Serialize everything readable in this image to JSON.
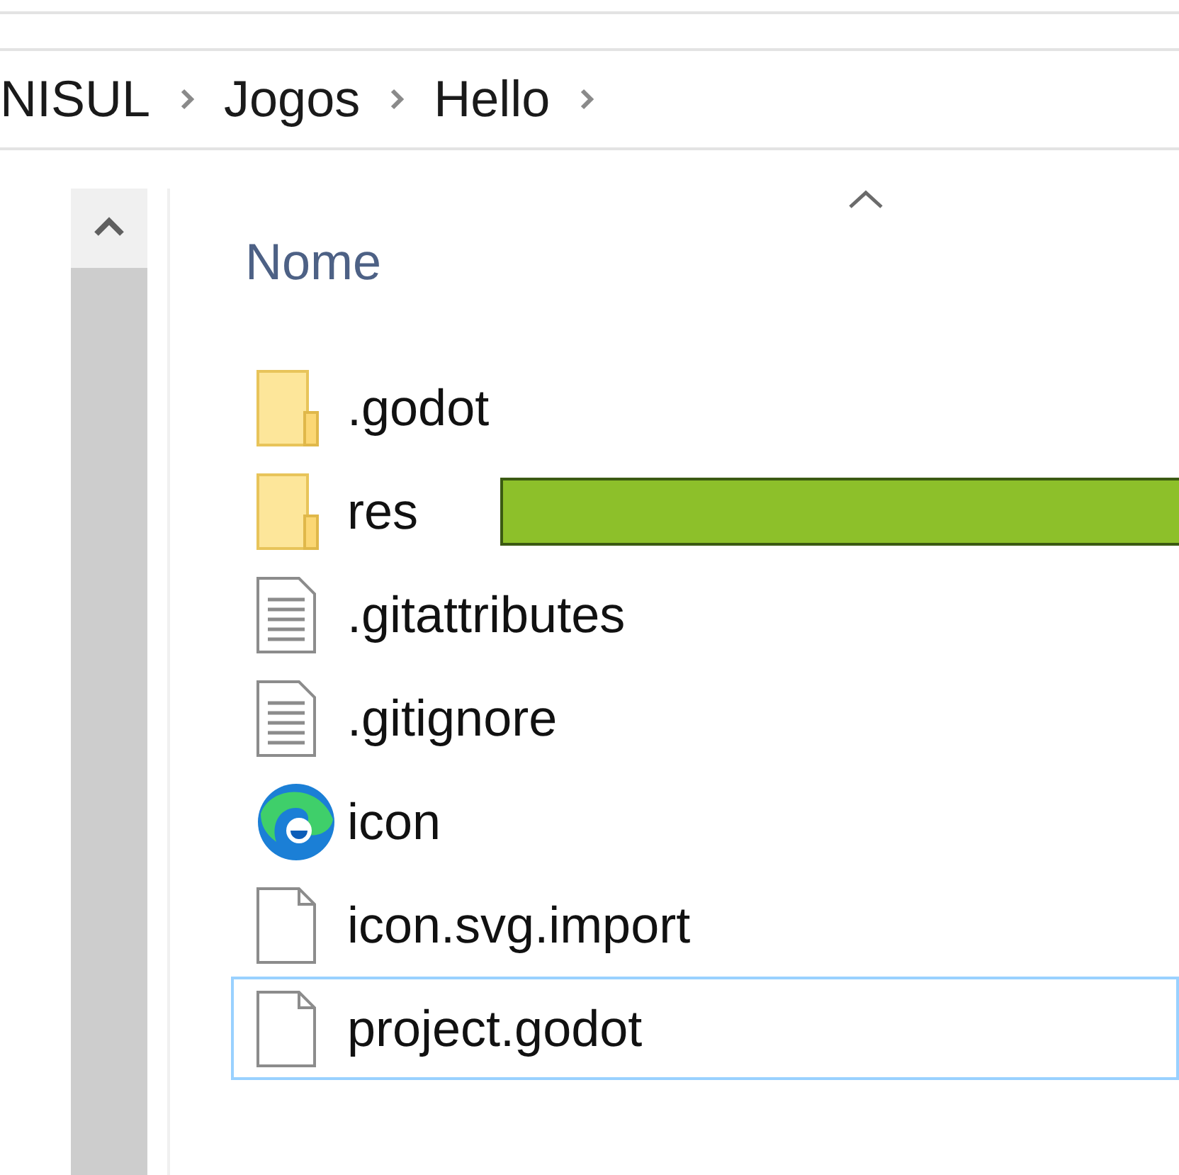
{
  "breadcrumb": [
    {
      "label": "NISUL"
    },
    {
      "label": "Jogos"
    },
    {
      "label": "Hello"
    }
  ],
  "column": {
    "label": "Nome",
    "sort_ascending": true
  },
  "files": [
    {
      "name": ".godot",
      "kind": "folder",
      "marked": false,
      "focused": false
    },
    {
      "name": "res",
      "kind": "folder",
      "marked": true,
      "focused": false
    },
    {
      "name": ".gitattributes",
      "kind": "text",
      "marked": false,
      "focused": false
    },
    {
      "name": ".gitignore",
      "kind": "text",
      "marked": false,
      "focused": false
    },
    {
      "name": "icon",
      "kind": "browser",
      "marked": false,
      "focused": false
    },
    {
      "name": "icon.svg.import",
      "kind": "file",
      "marked": false,
      "focused": false
    },
    {
      "name": "project.godot",
      "kind": "file",
      "marked": false,
      "focused": true
    }
  ]
}
